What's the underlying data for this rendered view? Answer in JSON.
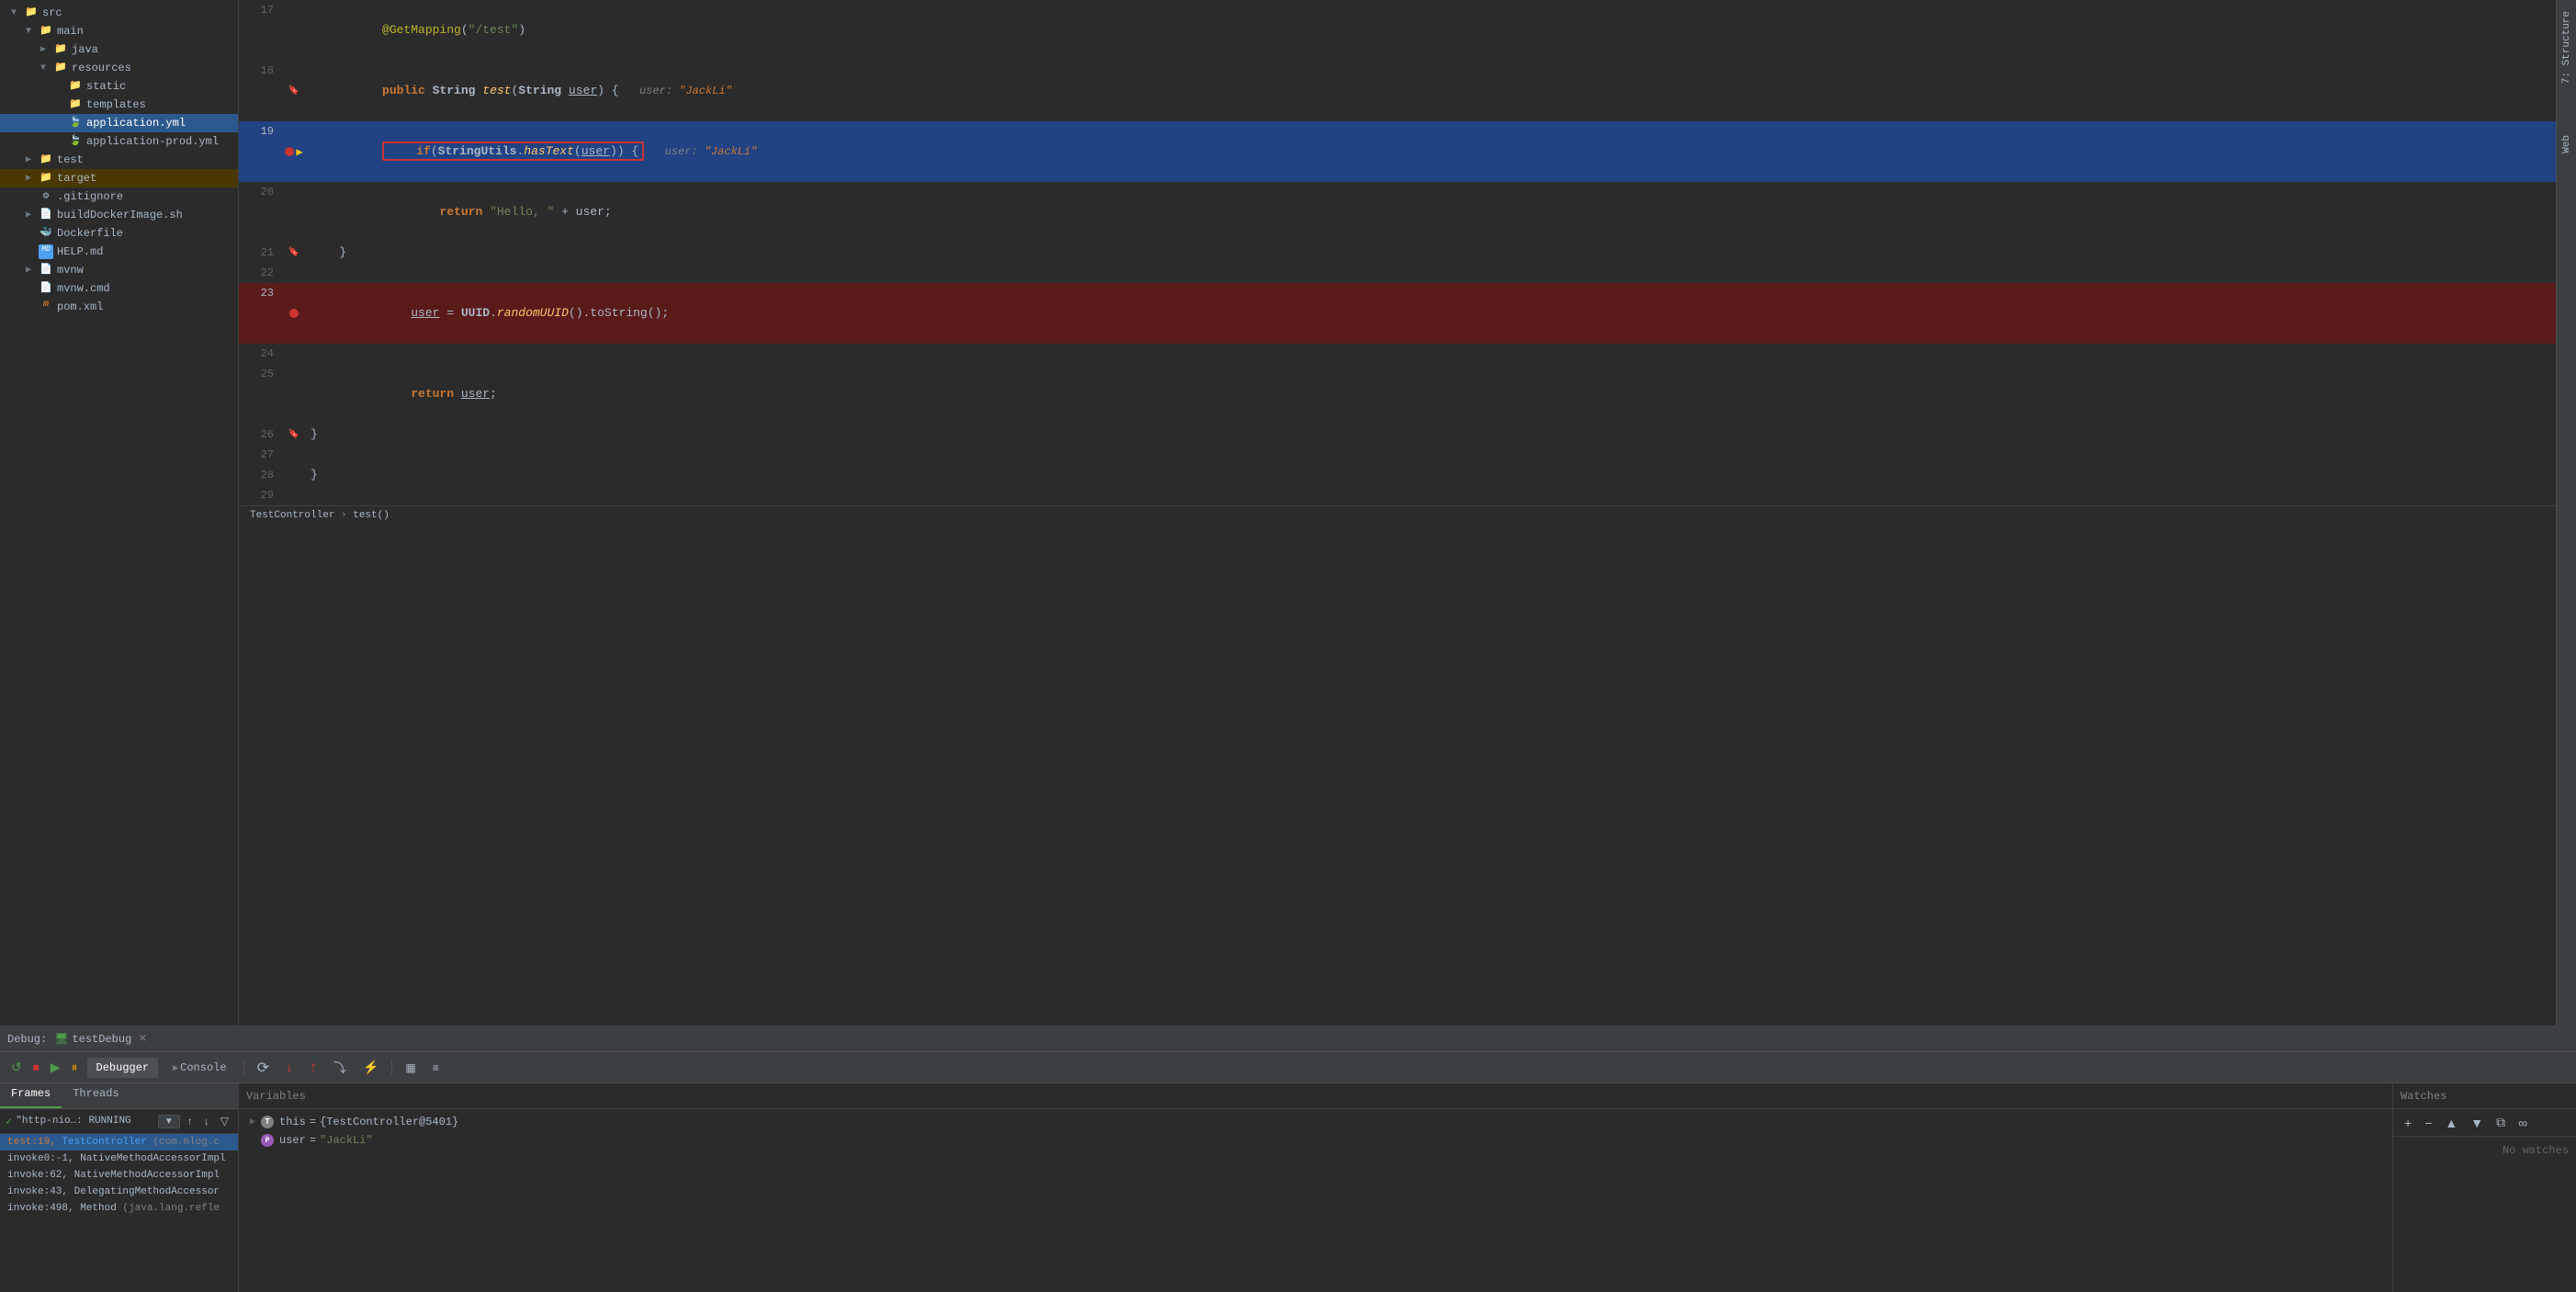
{
  "debug": {
    "label": "Debug:",
    "session_icon": "🖥",
    "session_name": "testDebug",
    "close": "×"
  },
  "toolbar": {
    "debugger_tab": "Debugger",
    "console_tab": "Console",
    "btn_rerun": "↺",
    "btn_stop": "⏹",
    "btn_resume": "▶",
    "btn_pause": "⏸",
    "btn_step_over": "↷",
    "btn_step_into": "↓",
    "btn_step_out": "↑",
    "btn_run_to": "→",
    "btn_mute": "🔇",
    "btn_grid": "▦",
    "btn_settings": "≡"
  },
  "frames": {
    "tab_frames": "Frames",
    "tab_threads": "Threads",
    "thread_name": "\"http-nio…: RUNNING",
    "thread_status": "RUNNING",
    "items": [
      {
        "id": 0,
        "line": "test:19",
        "class": "TestController",
        "pkg": "(com.mlog.c",
        "selected": true
      },
      {
        "id": 1,
        "line": "invoke0:-1",
        "class": "NativeMethodAccessorImpl",
        "pkg": "",
        "selected": false
      },
      {
        "id": 2,
        "line": "invoke:62",
        "class": "NativeMethodAccessorImpl",
        "pkg": "",
        "selected": false
      },
      {
        "id": 3,
        "line": "invoke:43",
        "class": "DelegatingMethodAccessor",
        "pkg": "",
        "selected": false
      },
      {
        "id": 4,
        "line": "invoke:498",
        "class": "Method",
        "pkg": "(java.lang.refle",
        "selected": false
      }
    ]
  },
  "variables": {
    "header": "Variables",
    "items": [
      {
        "name": "this",
        "icon_type": "this",
        "icon_label": "T",
        "value": "{TestController@5401}",
        "is_string": false,
        "expandable": true
      },
      {
        "name": "user",
        "icon_type": "user",
        "icon_label": "P",
        "value": "\"JackLi\"",
        "is_string": true,
        "expandable": false
      }
    ]
  },
  "watches": {
    "header": "Watches",
    "empty_text": "No watches"
  },
  "sidebar": {
    "items": [
      {
        "id": "src",
        "label": "src",
        "indent": 1,
        "type": "folder",
        "expanded": true,
        "arrow": "▼"
      },
      {
        "id": "main",
        "label": "main",
        "indent": 2,
        "type": "folder",
        "expanded": true,
        "arrow": "▼"
      },
      {
        "id": "java",
        "label": "java",
        "indent": 3,
        "type": "folder",
        "expanded": false,
        "arrow": "▶"
      },
      {
        "id": "resources",
        "label": "resources",
        "indent": 3,
        "type": "folder",
        "expanded": true,
        "arrow": "▼"
      },
      {
        "id": "static",
        "label": "static",
        "indent": 4,
        "type": "folder",
        "expanded": false,
        "arrow": ""
      },
      {
        "id": "templates",
        "label": "templates",
        "indent": 4,
        "type": "folder",
        "expanded": false,
        "arrow": ""
      },
      {
        "id": "application.yml",
        "label": "application.yml",
        "indent": 4,
        "type": "yml",
        "selected": true
      },
      {
        "id": "application-prod.yml",
        "label": "application-prod.yml",
        "indent": 4,
        "type": "yml"
      },
      {
        "id": "test",
        "label": "test",
        "indent": 2,
        "type": "folder",
        "expanded": false,
        "arrow": "▶"
      },
      {
        "id": "target",
        "label": "target",
        "indent": 2,
        "type": "folder-orange",
        "expanded": false,
        "arrow": "▶"
      },
      {
        "id": ".gitignore",
        "label": ".gitignore",
        "indent": 2,
        "type": "gitignore"
      },
      {
        "id": "buildDockerImage.sh",
        "label": "buildDockerImage.sh",
        "indent": 2,
        "type": "sh",
        "arrow": "▶"
      },
      {
        "id": "Dockerfile",
        "label": "Dockerfile",
        "indent": 2,
        "type": "docker"
      },
      {
        "id": "HELP.md",
        "label": "HELP.md",
        "indent": 2,
        "type": "md"
      },
      {
        "id": "mvnw",
        "label": "mvnw",
        "indent": 2,
        "type": "mvnw",
        "arrow": "▶"
      },
      {
        "id": "mvnw.cmd",
        "label": "mvnw.cmd",
        "indent": 2,
        "type": "file"
      },
      {
        "id": "pom.xml",
        "label": "pom.xml",
        "indent": 2,
        "type": "xml"
      }
    ]
  },
  "code": {
    "breadcrumb": "TestController > test()",
    "lines": [
      {
        "num": 17,
        "content_html": "<span class='annotation'>@GetMapping</span>(<span class='str'>\"/test\"</span>)",
        "highlight": "",
        "gutter": ""
      },
      {
        "num": 18,
        "content_html": "<span class='kw'>public</span> <span class='type'>String</span> <span class='method'>test</span>(<span class='type'>String</span> <span class='param'>user</span>) {",
        "highlight": "",
        "gutter": "bookmark",
        "hint": "user: \"JackLi\""
      },
      {
        "num": 19,
        "content_html": "    <span class='highlight-box'><span class='kw'>if</span>(<span class='type'>StringUtils</span>.<span class='method'>hasText</span>(<span class='param'>user</span>)) {</span>",
        "highlight": "blue",
        "gutter": "breakpoint+arrow",
        "hint": "user: \"JackLi\""
      },
      {
        "num": 20,
        "content_html": "        <span class='kw'>return</span> <span class='str'>\"Hello, \"</span> + user;",
        "highlight": "",
        "gutter": ""
      },
      {
        "num": 21,
        "content_html": "    }",
        "highlight": "",
        "gutter": "bookmark"
      },
      {
        "num": 22,
        "content_html": "",
        "highlight": "",
        "gutter": ""
      },
      {
        "num": 23,
        "content_html": "    <span class='param'>user</span> = <span class='type'>UUID</span>.<span class='method'>randomUUID</span>().toString();",
        "highlight": "red",
        "gutter": "breakpoint"
      },
      {
        "num": 24,
        "content_html": "",
        "highlight": "",
        "gutter": ""
      },
      {
        "num": 25,
        "content_html": "    <span class='kw'>return</span> <span class='param'>user</span>;",
        "highlight": "",
        "gutter": ""
      },
      {
        "num": 26,
        "content_html": "}",
        "highlight": "",
        "gutter": "bookmark"
      },
      {
        "num": 27,
        "content_html": "",
        "highlight": "",
        "gutter": ""
      },
      {
        "num": 28,
        "content_html": "}",
        "highlight": "",
        "gutter": ""
      },
      {
        "num": 29,
        "content_html": "",
        "highlight": "",
        "gutter": ""
      }
    ]
  },
  "right_tabs": {
    "structure": "7: Structure",
    "web": "Web"
  }
}
